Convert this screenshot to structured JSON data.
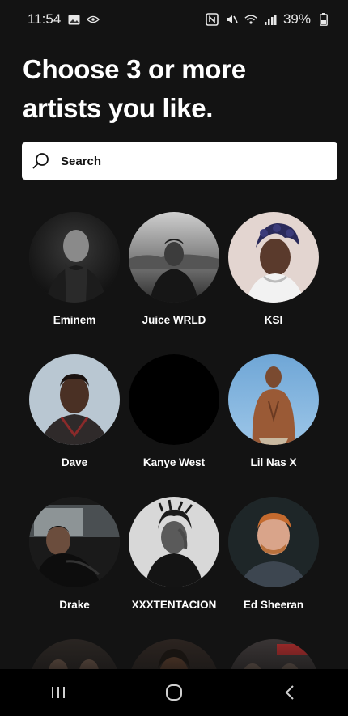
{
  "status_bar": {
    "time": "11:54",
    "battery": "39%",
    "icons_left": [
      "gallery-icon",
      "eye-comfort-icon"
    ],
    "icons_right": [
      "nfc-icon",
      "mute-icon",
      "wifi-icon",
      "signal-icon",
      "battery-icon"
    ]
  },
  "heading": {
    "line1": "Choose 3 or more",
    "line2": "artists you like."
  },
  "search": {
    "placeholder": "Search"
  },
  "artists": [
    {
      "name": "Eminem"
    },
    {
      "name": "Juice WRLD"
    },
    {
      "name": "KSI"
    },
    {
      "name": "Dave"
    },
    {
      "name": "Kanye West"
    },
    {
      "name": "Lil Nas X"
    },
    {
      "name": "Drake"
    },
    {
      "name": "XXXTENTACION"
    },
    {
      "name": "Ed Sheeran"
    }
  ],
  "nav": {
    "buttons": [
      "recent-apps",
      "home",
      "back"
    ]
  },
  "colors": {
    "background": "#131313",
    "text": "#ffffff",
    "search_bg": "#ffffff"
  }
}
